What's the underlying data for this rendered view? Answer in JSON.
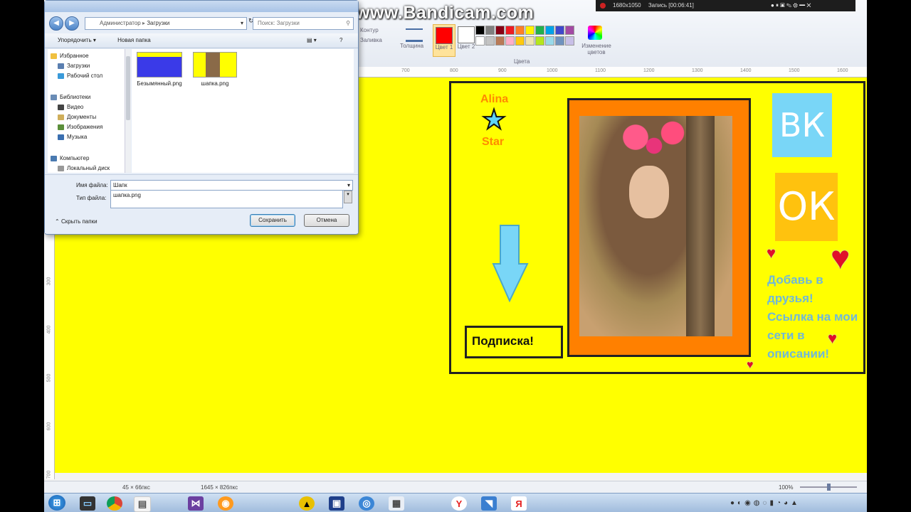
{
  "recorder": {
    "watermark": "www.Bandicam.com",
    "resolution": "1680x1050",
    "recording": "Запись [00:06:41]"
  },
  "ribbon": {
    "contour": "Контур",
    "fill": "Заливка",
    "thickness": "Толщина",
    "color1": "Цвет 1",
    "color2": "Цвет 2",
    "edit_colors": "Изменение цветов",
    "colors_group": "Цвета",
    "color1_value": "#ff0000",
    "color2_value": "#ffffff",
    "palette": [
      "#000000",
      "#7f7f7f",
      "#880015",
      "#ed1c24",
      "#ff7f27",
      "#fff200",
      "#22b14c",
      "#00a2e8",
      "#3f48cc",
      "#a349a4",
      "#ffffff",
      "#c3c3c3",
      "#b97a57",
      "#ffaec9",
      "#ffc90e",
      "#efe4b0",
      "#b5e61d",
      "#99d9ea",
      "#7092be",
      "#c8bfe7"
    ]
  },
  "ruler": {
    "ticks": [
      "700",
      "800",
      "900",
      "1000",
      "1100",
      "1200",
      "1300",
      "1400",
      "1500",
      "1600"
    ],
    "left_ticks": [
      "300",
      "400",
      "500",
      "600",
      "700"
    ]
  },
  "dialog": {
    "address_parts": [
      "Администратор",
      "Загрузки"
    ],
    "search_placeholder": "Поиск: Загрузки",
    "organize": "Упорядочить",
    "new_folder": "Новая папка",
    "nav": {
      "favorites": "Избранное",
      "downloads": "Загрузки",
      "desktop": "Рабочий стол",
      "libraries": "Библиотеки",
      "video": "Видео",
      "documents": "Документы",
      "images": "Изображения",
      "music": "Музыка",
      "computer": "Компьютер",
      "local_disk": "Локальный диск"
    },
    "files": [
      "Безымянный.png",
      "шапка.png"
    ],
    "filename_label": "Имя файла:",
    "filename_value": "Шапк",
    "filetype_label": "Тип файла:",
    "suggestion": "шапка.png",
    "hide_folders": "Скрыть папки",
    "save": "Сохранить",
    "cancel": "Отмена"
  },
  "canvas": {
    "name_top": "Alina",
    "name_bottom": "Star",
    "subscribe": "Подписка!",
    "vk": "ВК",
    "ok": "ОК",
    "cta_lines": [
      "Добавь в",
      "друзья!",
      "Ссылка на мои",
      "сети в",
      "описании!"
    ]
  },
  "status": {
    "cursor": "45 × 66пкс",
    "size": "1645 × 826пкс",
    "zoom": "100%"
  },
  "colors": {
    "canvas": "#ffff00",
    "frame": "#ff8000",
    "vk": "#79d6f7",
    "ok": "#ffc20e"
  }
}
